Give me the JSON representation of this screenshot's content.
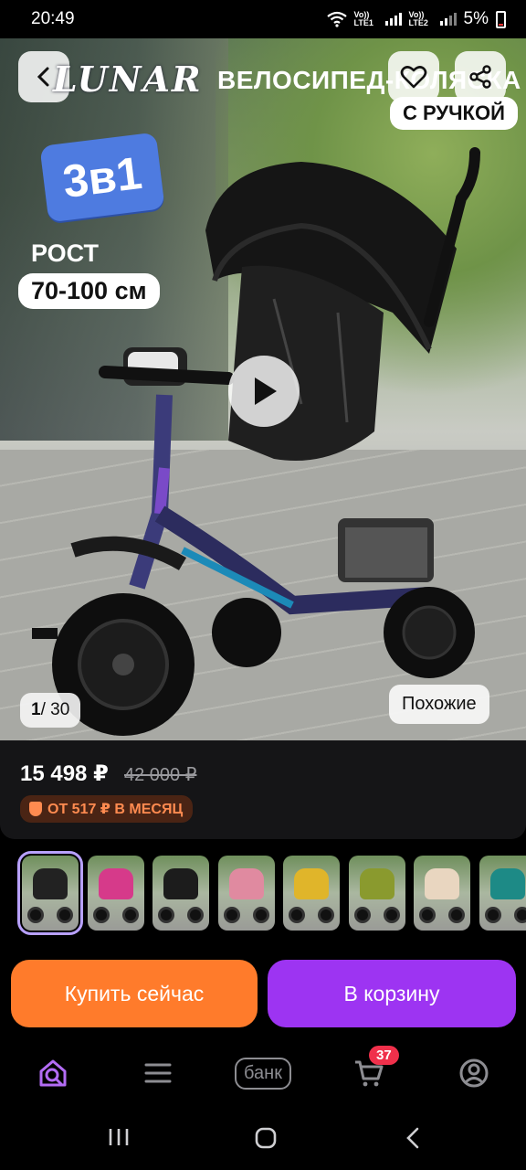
{
  "status_bar": {
    "time": "20:49",
    "sim1_label": "Vo)) LTE1",
    "sim2_label": "Vo)) LTE2",
    "battery": "5%"
  },
  "hero": {
    "logo_text": "LUNAR",
    "title": "ВЕЛОСИПЕД-КОЛЯСКА",
    "title_pill": "С РУЧКОЙ",
    "badge": "3в1",
    "height_label": "РОСТ",
    "height_value": "70-100 см",
    "counter_current": "1",
    "counter_total": "/ 30",
    "similar_label": "Похожие"
  },
  "price": {
    "current": "15 498 ₽",
    "old": "42 000 ₽",
    "installment": "ОТ 517 ₽ В МЕСЯЦ"
  },
  "thumbnails": [
    {
      "color": "#222222",
      "selected": true
    },
    {
      "color": "#d63a8a",
      "selected": false
    },
    {
      "color": "#1c1c1c",
      "selected": false
    },
    {
      "color": "#e08aa0",
      "selected": false
    },
    {
      "color": "#e0b52a",
      "selected": false
    },
    {
      "color": "#8a9a2e",
      "selected": false
    },
    {
      "color": "#e9d6c0",
      "selected": false
    },
    {
      "color": "#1d8a86",
      "selected": false
    }
  ],
  "actions": {
    "buy_now": "Купить сейчас",
    "add_to_cart": "В корзину"
  },
  "bottom_nav": {
    "bank_label": "банк",
    "cart_count": "37",
    "active_color": "#b36cf5",
    "icon_color": "#8d8d92"
  },
  "icons": [
    "back-icon",
    "heart-icon",
    "share-icon",
    "play-icon",
    "home-search-icon",
    "menu-icon",
    "cart-icon",
    "profile-icon"
  ]
}
